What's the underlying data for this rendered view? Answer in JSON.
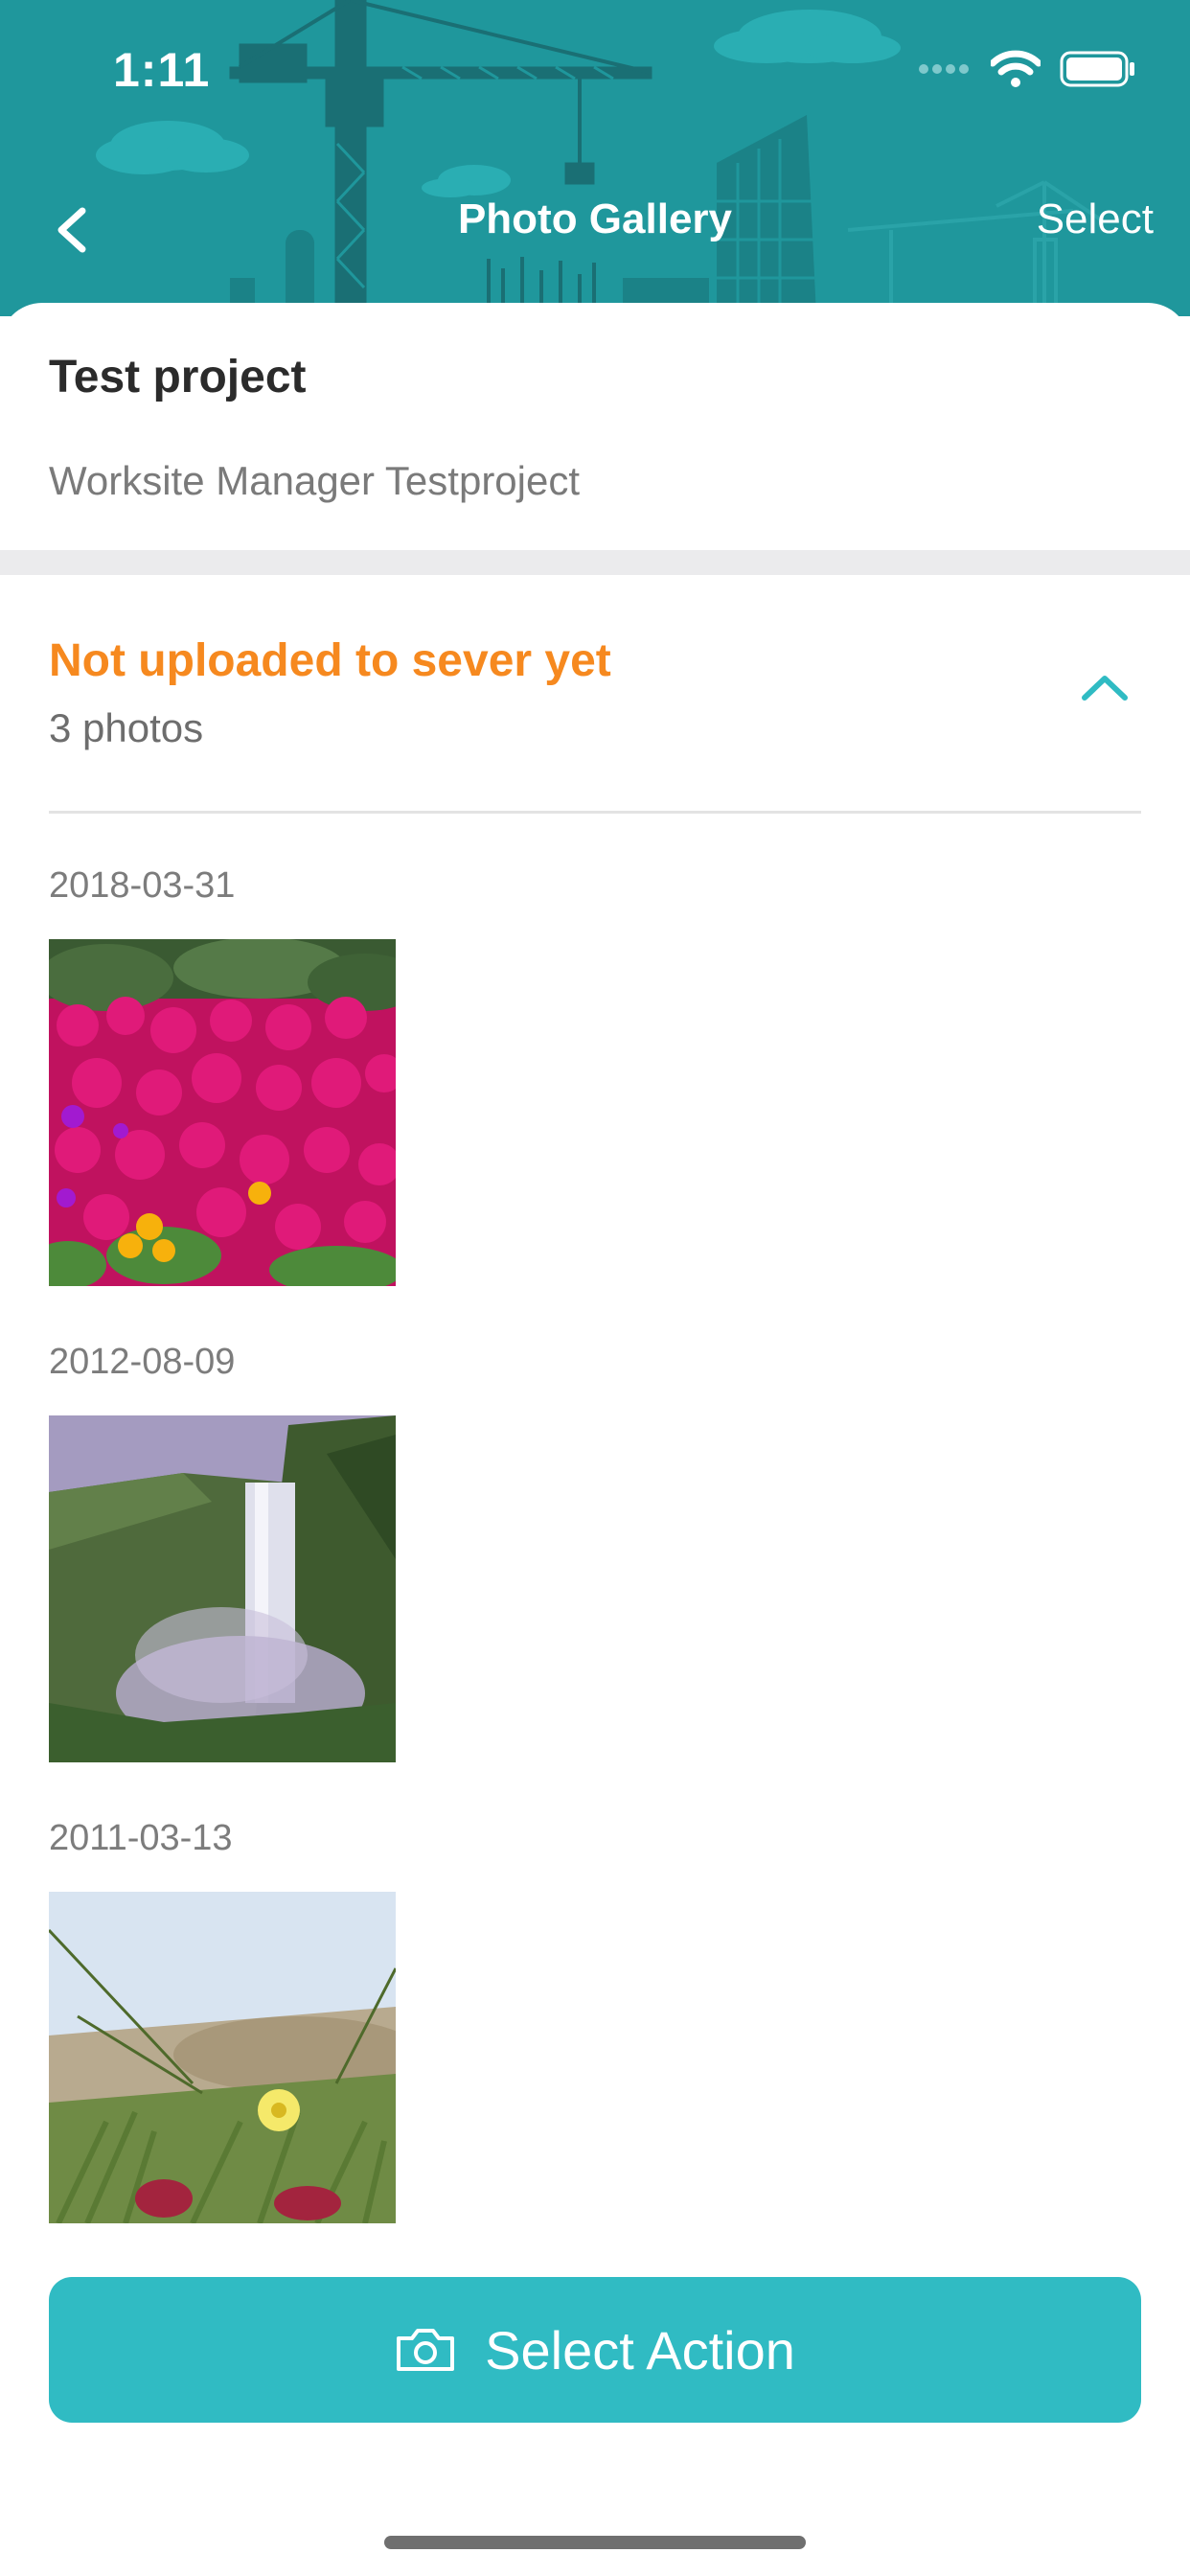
{
  "status_bar": {
    "time": "1:11"
  },
  "nav": {
    "title": "Photo Gallery",
    "select_label": "Select"
  },
  "project": {
    "title": "Test project",
    "subtitle": "Worksite Manager Testproject"
  },
  "section": {
    "title": "Not uploaded to sever yet",
    "count": "3 photos",
    "expanded": true
  },
  "photos": [
    {
      "date": "2018-03-31",
      "subject": "pink flower field"
    },
    {
      "date": "2012-08-09",
      "subject": "waterfall"
    },
    {
      "date": "2011-03-13",
      "subject": "yellow flower in grass"
    }
  ],
  "action": {
    "label": "Select Action",
    "icon": "camera-icon"
  },
  "colors": {
    "header_bg": "#1f979c",
    "accent": "#30bbc3",
    "warning": "#f6891f"
  }
}
